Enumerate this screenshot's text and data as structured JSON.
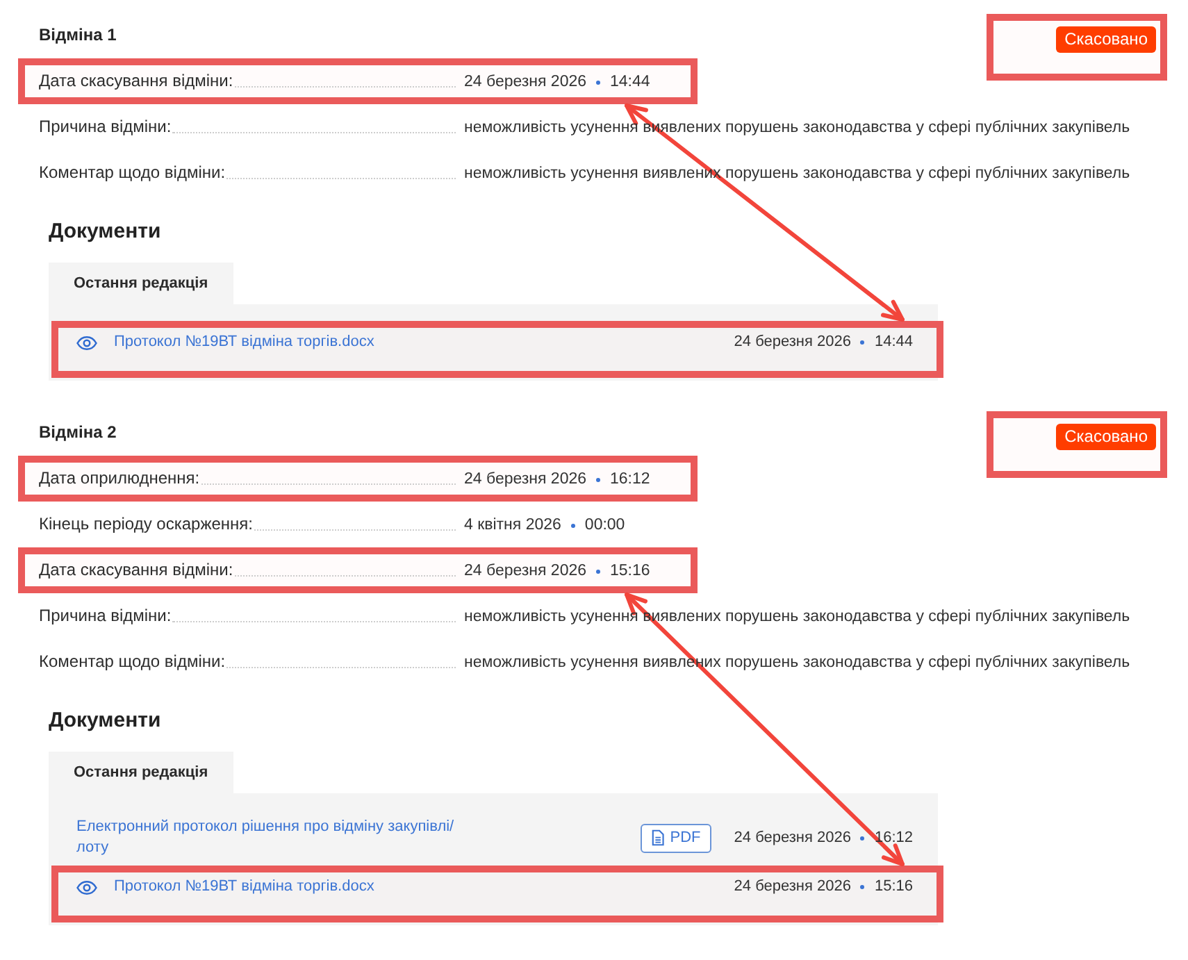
{
  "sections": [
    {
      "title": "Відміна 1",
      "status": {
        "label": "Скасовано",
        "highlighted": true
      },
      "fields": [
        {
          "kind": "datetime",
          "label": "Дата скасування відміни:",
          "date": "24 березня 2026",
          "time": "14:44",
          "highlighted": true,
          "arrow_end": true
        },
        {
          "kind": "text",
          "label": "Причина відміни:",
          "value": "неможливість усунення виявлених порушень законодавства у сфері публічних закупівель",
          "highlighted": false,
          "arrow_end": false
        },
        {
          "kind": "text",
          "label": "Коментар щодо відміни:",
          "value": "неможливість усунення виявлених порушень законодавства у сфері публічних закупівель",
          "highlighted": false,
          "arrow_end": false
        }
      ],
      "documents": {
        "title": "Документи",
        "tabs": [
          {
            "label": "Остання редакція",
            "selected": true
          }
        ],
        "items": [
          {
            "kind": "preview",
            "name": "Протокол №19ВТ відміна торгів.docx",
            "date": "24 березня 2026",
            "time": "14:44",
            "highlighted": true,
            "arrow_end": true
          }
        ]
      }
    },
    {
      "title": "Відміна 2",
      "status": {
        "label": "Скасовано",
        "highlighted": true
      },
      "fields": [
        {
          "kind": "datetime",
          "label": "Дата оприлюднення:",
          "date": "24 березня 2026",
          "time": "16:12",
          "highlighted": true,
          "arrow_end": false
        },
        {
          "kind": "datetime",
          "label": "Кінець періоду оскарження:",
          "date": "4 квітня 2026",
          "time": "00:00",
          "highlighted": false,
          "arrow_end": false
        },
        {
          "kind": "datetime",
          "label": "Дата скасування відміни:",
          "date": "24 березня 2026",
          "time": "15:16",
          "highlighted": true,
          "arrow_end": true
        },
        {
          "kind": "text",
          "label": "Причина відміни:",
          "value": "неможливість усунення виявлених порушень законодавства у сфері публічних закупівель",
          "highlighted": false,
          "arrow_end": false
        },
        {
          "kind": "text",
          "label": "Коментар щодо відміни:",
          "value": "неможливість усунення виявлених порушень законодавства у сфері публічних закупівель",
          "highlighted": false,
          "arrow_end": false
        }
      ],
      "documents": {
        "title": "Документи",
        "tabs": [
          {
            "label": "Остання редакція",
            "selected": true
          }
        ],
        "items": [
          {
            "kind": "pdf",
            "name": "Електронний протокол рішення про відміну закупівлі/лоту",
            "button": "PDF",
            "date": "24 березня 2026",
            "time": "16:12",
            "highlighted": false,
            "arrow_end": false
          },
          {
            "kind": "preview",
            "name": "Протокол №19ВТ відміна торгів.docx",
            "date": "24 березня 2026",
            "time": "15:16",
            "highlighted": true,
            "arrow_end": true
          }
        ]
      }
    }
  ]
}
